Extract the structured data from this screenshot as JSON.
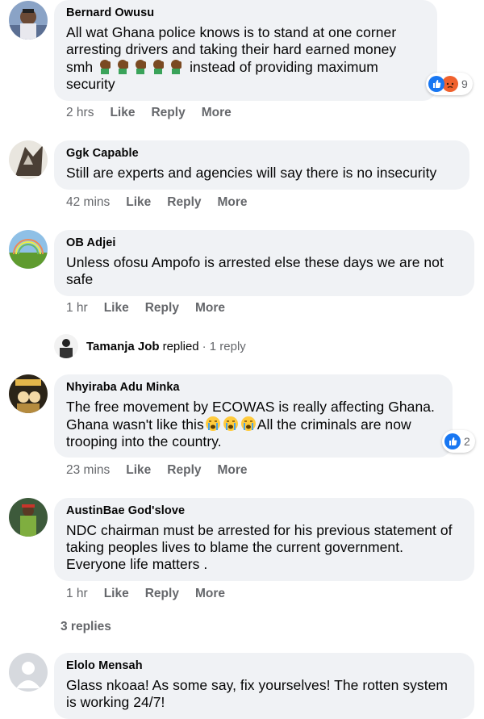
{
  "comments": [
    {
      "author": "Bernard Owusu",
      "text_before": "All wat Ghana police knows is to stand at one corner arresting drivers and taking their hard earned money smh",
      "emoji": "🤦🏾‍♂️🤦🏾‍♂️🤦🏾‍♂️🤦🏾‍♂️🤦🏾‍♂️",
      "text_after": "instead of providing maximum security",
      "time": "2 hrs",
      "like": "Like",
      "reply": "Reply",
      "more": "More",
      "reactions": {
        "count": "9",
        "types": [
          "like-icon",
          "angry-icon"
        ]
      }
    },
    {
      "author": "Ggk Capable",
      "text": "Still are experts and agencies will say there is no insecurity",
      "time": "42 mins",
      "like": "Like",
      "reply": "Reply",
      "more": "More"
    },
    {
      "author": "OB Adjei",
      "text": "Unless ofosu Ampofo is arrested else these days we are not safe",
      "time": "1 hr",
      "like": "Like",
      "reply": "Reply",
      "more": "More",
      "replied_by": "Tamanja Job",
      "replied_word": "replied",
      "reply_count": "· 1 reply"
    },
    {
      "author": "Nhyiraba Adu Minka",
      "text_before": "The free movement by ECOWAS is really affecting Ghana. Ghana wasn't like this",
      "emoji": "😭😭😭",
      "text_after": "All the criminals are now trooping into the country.",
      "time": "23 mins",
      "like": "Like",
      "reply": "Reply",
      "more": "More",
      "reactions": {
        "count": "2",
        "types": [
          "like-icon"
        ]
      }
    },
    {
      "author": "AustinBae God'slove",
      "text": "NDC chairman must be arrested for his previous statement of taking peoples lives to blame the current government. Everyone life matters .",
      "time": "1 hr",
      "like": "Like",
      "reply": "Reply",
      "more": "More",
      "more_replies": "3 replies"
    },
    {
      "author": "Elolo Mensah",
      "text": "Glass nkoaa! As some say, fix yourselves! The rotten system is working 24/7!"
    }
  ],
  "colors": {
    "bubble": "#f0f2f5",
    "secondary_text": "#65676b",
    "like_blue": "#1877f2",
    "angry_orange": "#f0612d"
  }
}
